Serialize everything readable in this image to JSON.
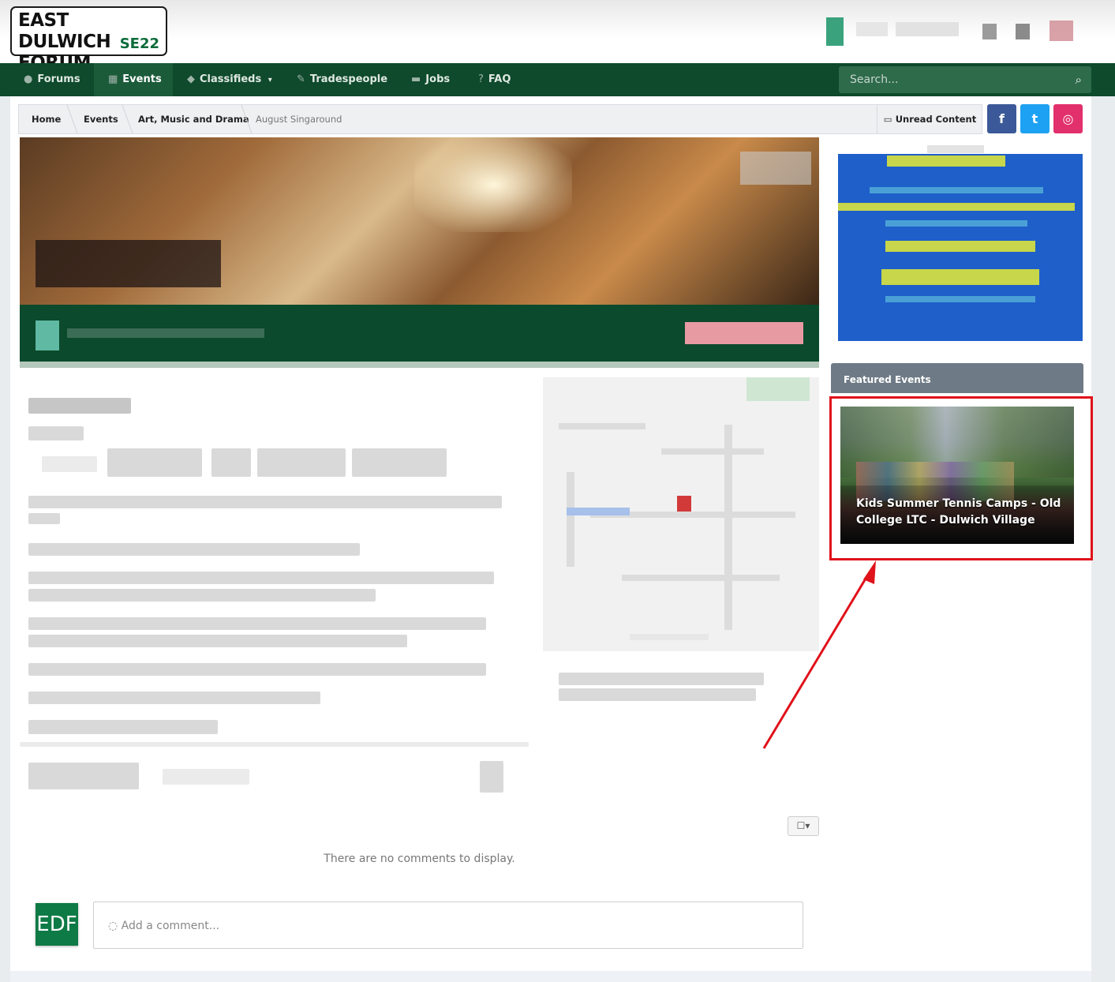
{
  "logo": {
    "line1": "EAST DULWICH",
    "line2": "FORUM",
    "badge": "SE22"
  },
  "nav": {
    "items": [
      {
        "label": "Forums",
        "icon": "chat-bubbles-icon"
      },
      {
        "label": "Events",
        "icon": "calendar-icon"
      },
      {
        "label": "Classifieds",
        "icon": "tags-icon"
      },
      {
        "label": "Tradespeople",
        "icon": "wrench-icon"
      },
      {
        "label": "Jobs",
        "icon": "briefcase-icon"
      },
      {
        "label": "FAQ",
        "icon": "question-circle-icon"
      }
    ],
    "classifieds_caret": "▾",
    "active": "Events"
  },
  "search": {
    "placeholder": "Search..."
  },
  "breadcrumb": [
    "Home",
    "Events",
    "Art, Music and Drama",
    "August Singaround"
  ],
  "unread": {
    "label": "Unread Content"
  },
  "social": {
    "facebook": "f",
    "twitter": "t",
    "instagram": "◎"
  },
  "featured": {
    "header": "Featured Events",
    "event_title": "Kids Summer Tennis Camps - Old College LTC - Dulwich Village"
  },
  "comments": {
    "empty_text": "There are no comments to display.",
    "placeholder": "Add a comment...",
    "avatar_text": "EDF"
  },
  "colors": {
    "nav_bg": "#0e4a2b",
    "brand_green": "#0b6b3a",
    "highlight_red": "#e0121a",
    "facebook": "#3b5998",
    "twitter": "#1da1f2",
    "instagram": "#e1306c"
  }
}
